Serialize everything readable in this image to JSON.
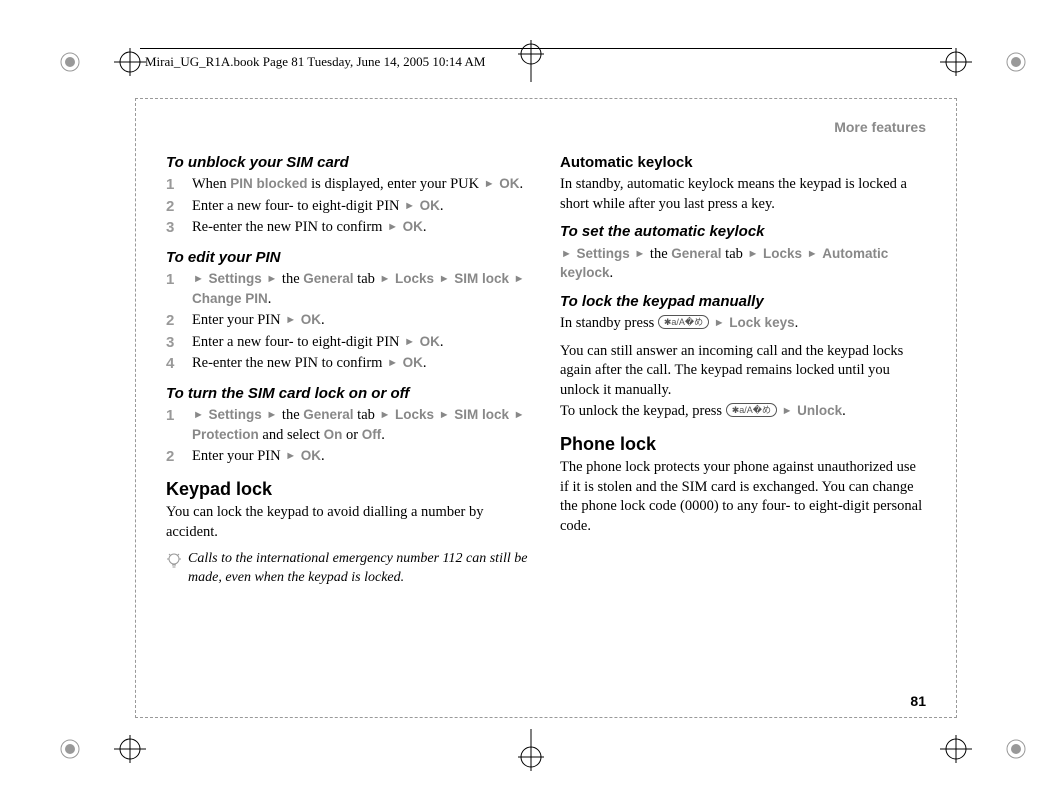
{
  "header": "Mirai_UG_R1A.book  Page 81  Tuesday, June 14, 2005  10:14 AM",
  "section": "More features",
  "page_number": "81",
  "left": {
    "h_unblock": "To unblock your SIM card",
    "s1_1a": "When ",
    "s1_1b": "PIN blocked",
    "s1_1c": " is displayed, enter your PUK ",
    "ok": "OK",
    "s1_2a": "Enter a new four- to eight-digit PIN ",
    "s1_3a": "Re-enter the new PIN to confirm ",
    "h_edit": "To edit your PIN",
    "m_settings": "Settings",
    "m_the": " the ",
    "m_general": "General",
    "m_tab": " tab ",
    "m_locks": "Locks",
    "m_simlock": "SIM lock",
    "m_changepin": "Change PIN",
    "s2_2a": "Enter your PIN ",
    "s2_3a": "Enter a new four- to eight-digit PIN ",
    "s2_4a": "Re-enter the new PIN to confirm ",
    "h_onoff": "To turn the SIM card lock on or off",
    "m_protection": "Protection",
    "m_andselect": " and select ",
    "m_on": "On",
    "m_or": " or ",
    "m_off": "Off",
    "s3_2a": "Enter your PIN ",
    "h_keypad": "Keypad lock",
    "p_keypad": "You can lock the keypad to avoid dialling a number by accident.",
    "tip": "Calls to the international emergency number 112 can still be made, even when the keypad is locked."
  },
  "right": {
    "h_auto": "Automatic keylock",
    "p_auto": "In standby, automatic keylock means the keypad is locked a short while after you last press a key.",
    "h_setauto": "To set the automatic keylock",
    "m_autokeylock": "Automatic keylock",
    "h_manual": "To lock the keypad manually",
    "p_manual_a": "In standby press ",
    "m_lockkeys": "Lock keys",
    "p_manual_b": "You can still answer an incoming call and the keypad locks again after the call. The keypad remains locked until you unlock it manually.",
    "p_manual_c": "To unlock the keypad, press ",
    "m_unlock": "Unlock",
    "h_phonelock": "Phone lock",
    "p_phonelock": "The phone lock protects your phone against unauthorized use if it is stolen and the SIM card is exchanged. You can change the phone lock code (0000) to any four- to eight-digit personal code.",
    "key_star": "✱a/A�め"
  }
}
